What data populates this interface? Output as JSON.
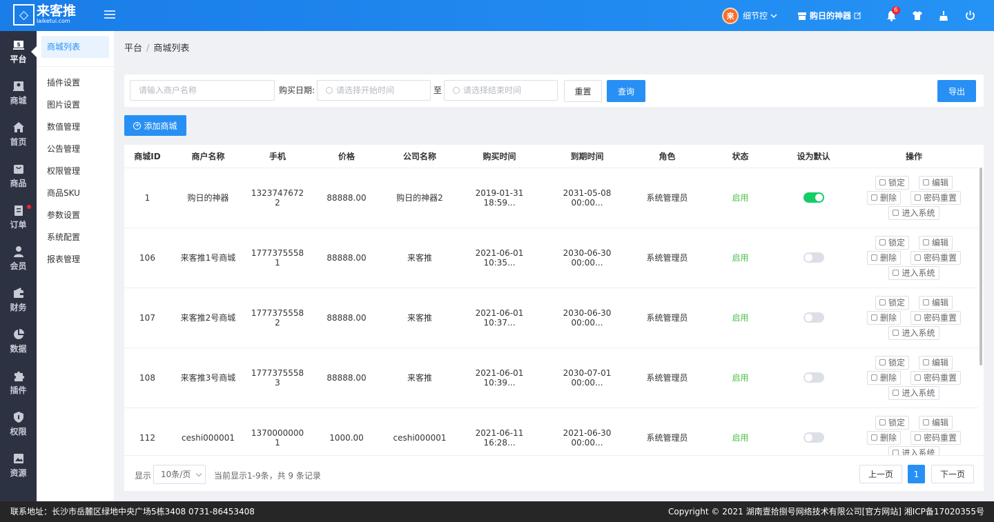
{
  "brand": {
    "logo_text": "来客推",
    "logo_url": "laiketui.com"
  },
  "header": {
    "user_avatar": "来",
    "user_name": "细节控",
    "store_name": "购日的神器",
    "notification_count": "6"
  },
  "rail": [
    {
      "label": "平台",
      "icon": "platform-icon",
      "active": true
    },
    {
      "label": "商城",
      "icon": "mall-icon"
    },
    {
      "label": "首页",
      "icon": "home-icon"
    },
    {
      "label": "商品",
      "icon": "goods-icon"
    },
    {
      "label": "订单",
      "icon": "order-icon",
      "dot": true
    },
    {
      "label": "会员",
      "icon": "member-icon"
    },
    {
      "label": "财务",
      "icon": "finance-icon"
    },
    {
      "label": "数据",
      "icon": "data-icon"
    },
    {
      "label": "插件",
      "icon": "plugin-icon"
    },
    {
      "label": "权限",
      "icon": "permission-icon"
    },
    {
      "label": "资源",
      "icon": "resource-icon"
    }
  ],
  "submenu": [
    "商城列表",
    "插件设置",
    "图片设置",
    "数值管理",
    "公告管理",
    "权限管理",
    "商品SKU",
    "参数设置",
    "系统配置",
    "报表管理"
  ],
  "breadcrumb": {
    "root": "平台",
    "current": "商城列表"
  },
  "filters": {
    "merchant_placeholder": "请输入商户名称",
    "date_label": "购买日期:",
    "start_placeholder": "请选择开始时间",
    "to_label": "至",
    "end_placeholder": "请选择结束时间",
    "reset": "重置",
    "query": "查询",
    "export": "导出"
  },
  "add_button": "添加商城",
  "table": {
    "headers": [
      "商城ID",
      "商户名称",
      "手机",
      "价格",
      "公司名称",
      "购买时间",
      "到期时间",
      "角色",
      "状态",
      "设为默认",
      "操作"
    ],
    "rows": [
      {
        "id": "1",
        "name": "购日的神器",
        "phone": [
          "1323747672",
          "2"
        ],
        "price": "88888.00",
        "company": "购日的神器2",
        "buy": "2019-01-31 18:59...",
        "expire": "2031-05-08 00:00...",
        "role": "系统管理员",
        "status": "启用",
        "default": true
      },
      {
        "id": "106",
        "name": "来客推1号商城",
        "phone": [
          "1777375558",
          "1"
        ],
        "price": "88888.00",
        "company": "来客推",
        "buy": "2021-06-01 10:35...",
        "expire": "2030-06-30 00:00...",
        "role": "系统管理员",
        "status": "启用",
        "default": false
      },
      {
        "id": "107",
        "name": "来客推2号商城",
        "phone": [
          "1777375558",
          "2"
        ],
        "price": "88888.00",
        "company": "来客推",
        "buy": "2021-06-01 10:37...",
        "expire": "2030-06-30 00:00...",
        "role": "系统管理员",
        "status": "启用",
        "default": false
      },
      {
        "id": "108",
        "name": "来客推3号商城",
        "phone": [
          "1777375558",
          "3"
        ],
        "price": "88888.00",
        "company": "来客推",
        "buy": "2021-06-01 10:39...",
        "expire": "2030-07-01 00:00...",
        "role": "系统管理员",
        "status": "启用",
        "default": false
      },
      {
        "id": "112",
        "name": "ceshi000001",
        "phone": [
          "1370000000",
          "1"
        ],
        "price": "1000.00",
        "company": "ceshi000001",
        "buy": "2021-06-11 16:28...",
        "expire": "2021-06-30 00:00...",
        "role": "系统管理员",
        "status": "启用",
        "default": false
      }
    ],
    "ops": {
      "lock": "锁定",
      "edit": "编辑",
      "delete": "删除",
      "reset_pwd": "密码重置",
      "enter": "进入系统"
    }
  },
  "pager": {
    "show": "显示",
    "page_size": "10条/页",
    "summary": "当前显示1-9条，共 9 条记录",
    "prev": "上一页",
    "current": "1",
    "next": "下一页"
  },
  "footer": {
    "address": "联系地址：长沙市岳麓区绿地中央广场5栋3408 0731-86453408",
    "copyright": "Copyright © 2021 湖南壹拾捌号网络技术有限公司[官方网站]   湘ICP备17020355号"
  },
  "colors": {
    "primary": "#2890f4",
    "rail": "#2d3243",
    "success": "#4cbf4a",
    "toggle_on": "#13ce66"
  }
}
